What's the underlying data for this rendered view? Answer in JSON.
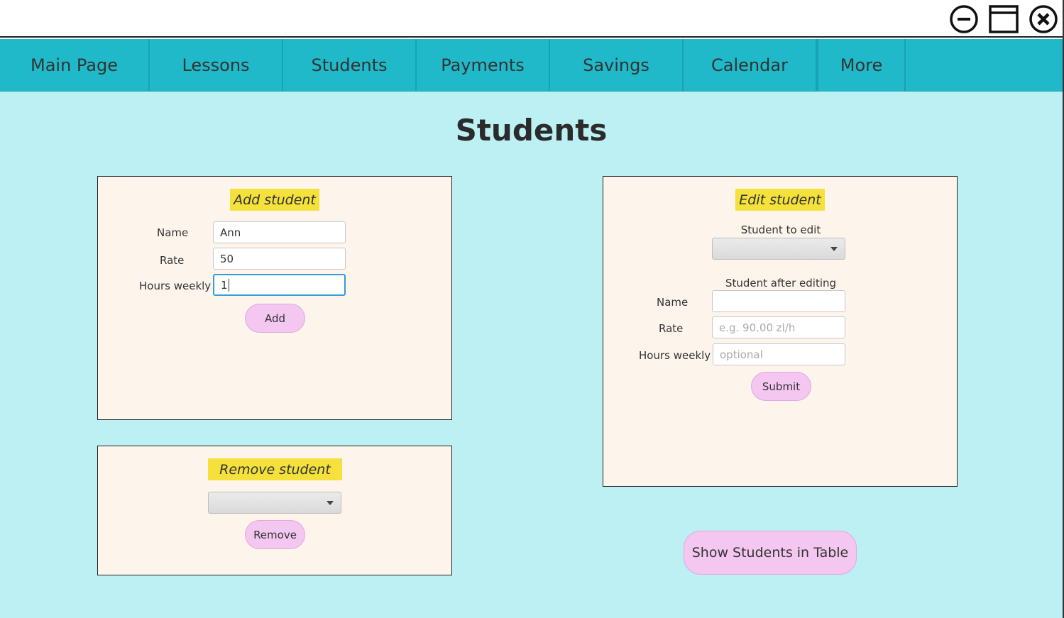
{
  "window": {
    "minimize_icon": "minus-circle-icon",
    "maximize_icon": "window-icon",
    "close_icon": "x-circle-icon"
  },
  "nav": {
    "items": [
      "Main Page",
      "Lessons",
      "Students",
      "Payments",
      "Savings",
      "Calendar",
      "More"
    ]
  },
  "page": {
    "title": "Students"
  },
  "add_student": {
    "title": "Add student",
    "name_label": "Name",
    "name_value": "Ann",
    "rate_label": "Rate",
    "rate_value": "50",
    "hours_label": "Hours weekly",
    "hours_value": "1",
    "button": "Add"
  },
  "remove_student": {
    "title": "Remove student",
    "selected": "",
    "button": "Remove"
  },
  "edit_student": {
    "title": "Edit student",
    "student_to_edit_label": "Student to edit",
    "selected": "",
    "after_label": "Student after editing",
    "name_label": "Name",
    "name_value": "",
    "rate_label": "Rate",
    "rate_placeholder": "e.g. 90.00 zl/h",
    "hours_label": "Hours weekly",
    "hours_placeholder": "optional",
    "button": "Submit"
  },
  "show_table_button": "Show Students in Table",
  "colors": {
    "nav_bg": "#1fb9c9",
    "page_bg": "#bdf0f3",
    "panel_bg": "#fdf4ec",
    "panel_title_bg": "#f4e13c",
    "button_bg": "#f3c7f0"
  }
}
